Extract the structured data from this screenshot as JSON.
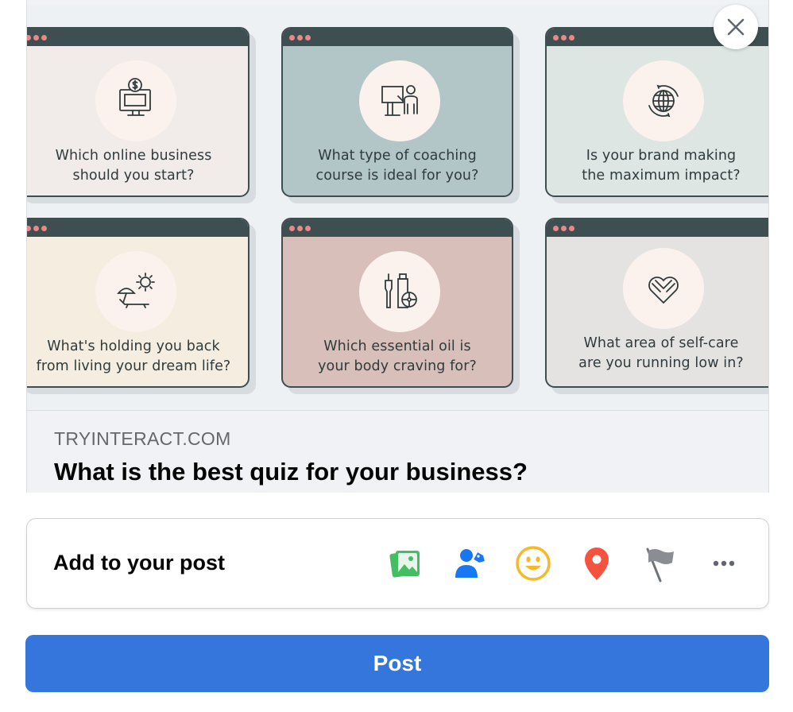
{
  "preview": {
    "cards": [
      {
        "text_line1": "Which online business",
        "text_line2": "should you start?",
        "icon": "computer-dollar-icon"
      },
      {
        "text_line1": "What type of coaching",
        "text_line2": "course is ideal for you?",
        "icon": "presenter-icon"
      },
      {
        "text_line1": "Is your brand making",
        "text_line2": "the maximum impact?",
        "icon": "globe-icon"
      },
      {
        "text_line1": "What's holding you back",
        "text_line2": "from living your dream life?",
        "icon": "beach-sun-icon"
      },
      {
        "text_line1": "Which essential oil is",
        "text_line2": "your body craving for?",
        "icon": "essential-oil-icon"
      },
      {
        "text_line1": "What area of self-care",
        "text_line2": "are you running low in?",
        "icon": "heart-hands-icon"
      }
    ],
    "domain": "TRYINTERACT.COM",
    "title": "What is the best quiz for your business?"
  },
  "add_to_post": {
    "label": "Add to your post",
    "icons": [
      "photo-video-icon",
      "tag-people-icon",
      "feeling-icon",
      "check-in-icon",
      "life-event-icon",
      "more-icon"
    ]
  },
  "post_button": {
    "label": "Post"
  },
  "colors": {
    "post_button": "#3576dd",
    "photo_icon": "#45bd62",
    "tag_icon": "#1877f2",
    "feeling_icon": "#f7b928",
    "location_icon": "#f5533d",
    "flag_icon": "#6e7378"
  }
}
